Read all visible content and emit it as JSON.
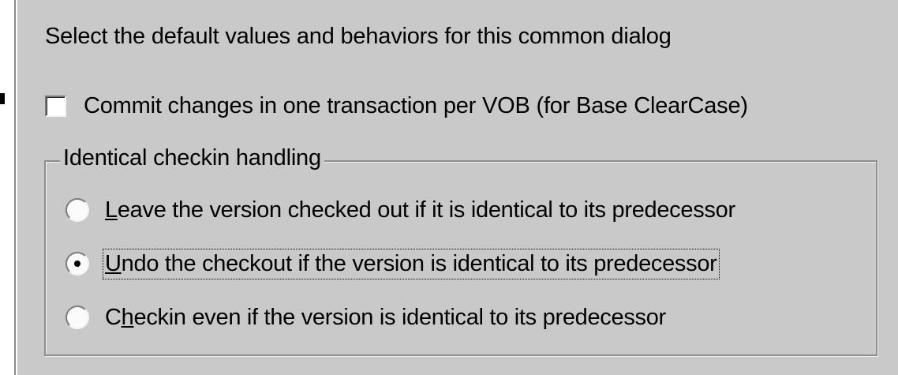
{
  "dialog": {
    "heading": "Select the default values and behaviors for this common dialog",
    "commit_checkbox": {
      "label": "Commit changes in one transaction per VOB (for Base ClearCase)",
      "checked": false
    },
    "group": {
      "title": "Identical checkin handling",
      "options": [
        {
          "mnemonic": "L",
          "rest": "eave the version checked out if it is identical to its predecessor",
          "selected": false
        },
        {
          "mnemonic": "U",
          "rest": "ndo the checkout if the version is identical to its predecessor",
          "selected": true
        },
        {
          "pre": "C",
          "mnemonic": "h",
          "rest": "eckin even if the version is identical to its predecessor",
          "selected": false
        }
      ]
    }
  },
  "colors": {
    "panel_bg": "#c9c9c9",
    "group_border": "#8e8e8e"
  }
}
